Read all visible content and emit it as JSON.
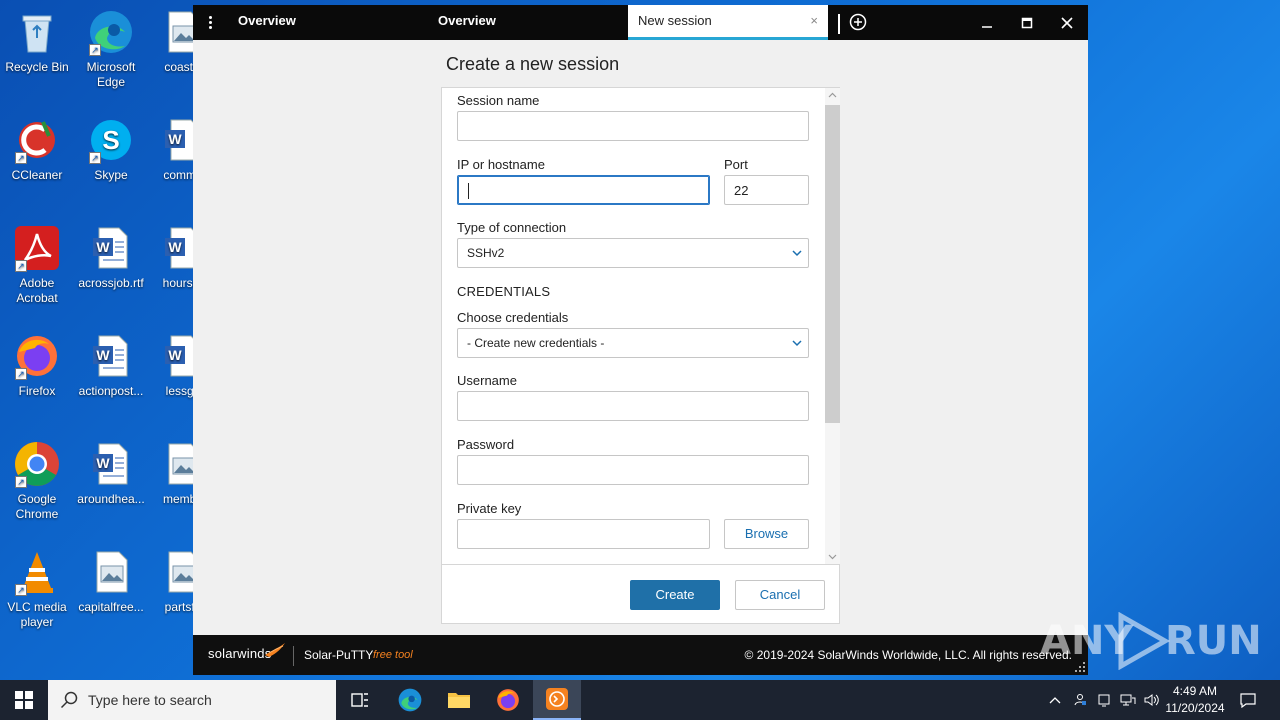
{
  "desktop": {
    "icons": [
      {
        "label": "Recycle Bin"
      },
      {
        "label": "Microsoft Edge"
      },
      {
        "label": "coastw"
      },
      {
        "label": "CCleaner"
      },
      {
        "label": "Skype"
      },
      {
        "label": "comma"
      },
      {
        "label": "Adobe Acrobat"
      },
      {
        "label": "acrossjob.rtf"
      },
      {
        "label": "hoursre"
      },
      {
        "label": "Firefox"
      },
      {
        "label": "actionpost..."
      },
      {
        "label": "lessgo"
      },
      {
        "label": "Google Chrome"
      },
      {
        "label": "aroundhea..."
      },
      {
        "label": "membe"
      },
      {
        "label": "VLC media player"
      },
      {
        "label": "capitalfree..."
      },
      {
        "label": "partsfe"
      }
    ]
  },
  "window": {
    "tabs": [
      {
        "label": "Overview"
      },
      {
        "label": "Overview"
      },
      {
        "label": "New session",
        "active": true
      }
    ],
    "close_tab_glyph": "×"
  },
  "form": {
    "title": "Create a new session",
    "session_name": {
      "label": "Session name",
      "value": ""
    },
    "host": {
      "label": "IP or hostname",
      "value": ""
    },
    "port": {
      "label": "Port",
      "value": "22"
    },
    "connection_type": {
      "label": "Type of connection",
      "value": "SSHv2"
    },
    "credentials_header": "CREDENTIALS",
    "choose_credentials": {
      "label": "Choose credentials",
      "value": "- Create new credentials -"
    },
    "username": {
      "label": "Username",
      "value": ""
    },
    "password": {
      "label": "Password",
      "value": ""
    },
    "private_key": {
      "label": "Private key",
      "value": ""
    },
    "browse_label": "Browse",
    "create_label": "Create",
    "cancel_label": "Cancel"
  },
  "footer": {
    "brand": "solarwinds",
    "product": "Solar-PuTTY",
    "tag": "free tool",
    "copyright": "© 2019-2024 SolarWinds Worldwide, LLC. All rights reserved."
  },
  "watermark": {
    "left": "ANY",
    "right": "RUN"
  },
  "taskbar": {
    "search_placeholder": "Type here to search",
    "time": "4:49 AM",
    "date": "11/20/2024"
  },
  "colors": {
    "accent": "#1f70a8",
    "tab_underline": "#27a6d4",
    "brand_orange": "#f58220",
    "desktop_blue": "#0f6fd6"
  }
}
